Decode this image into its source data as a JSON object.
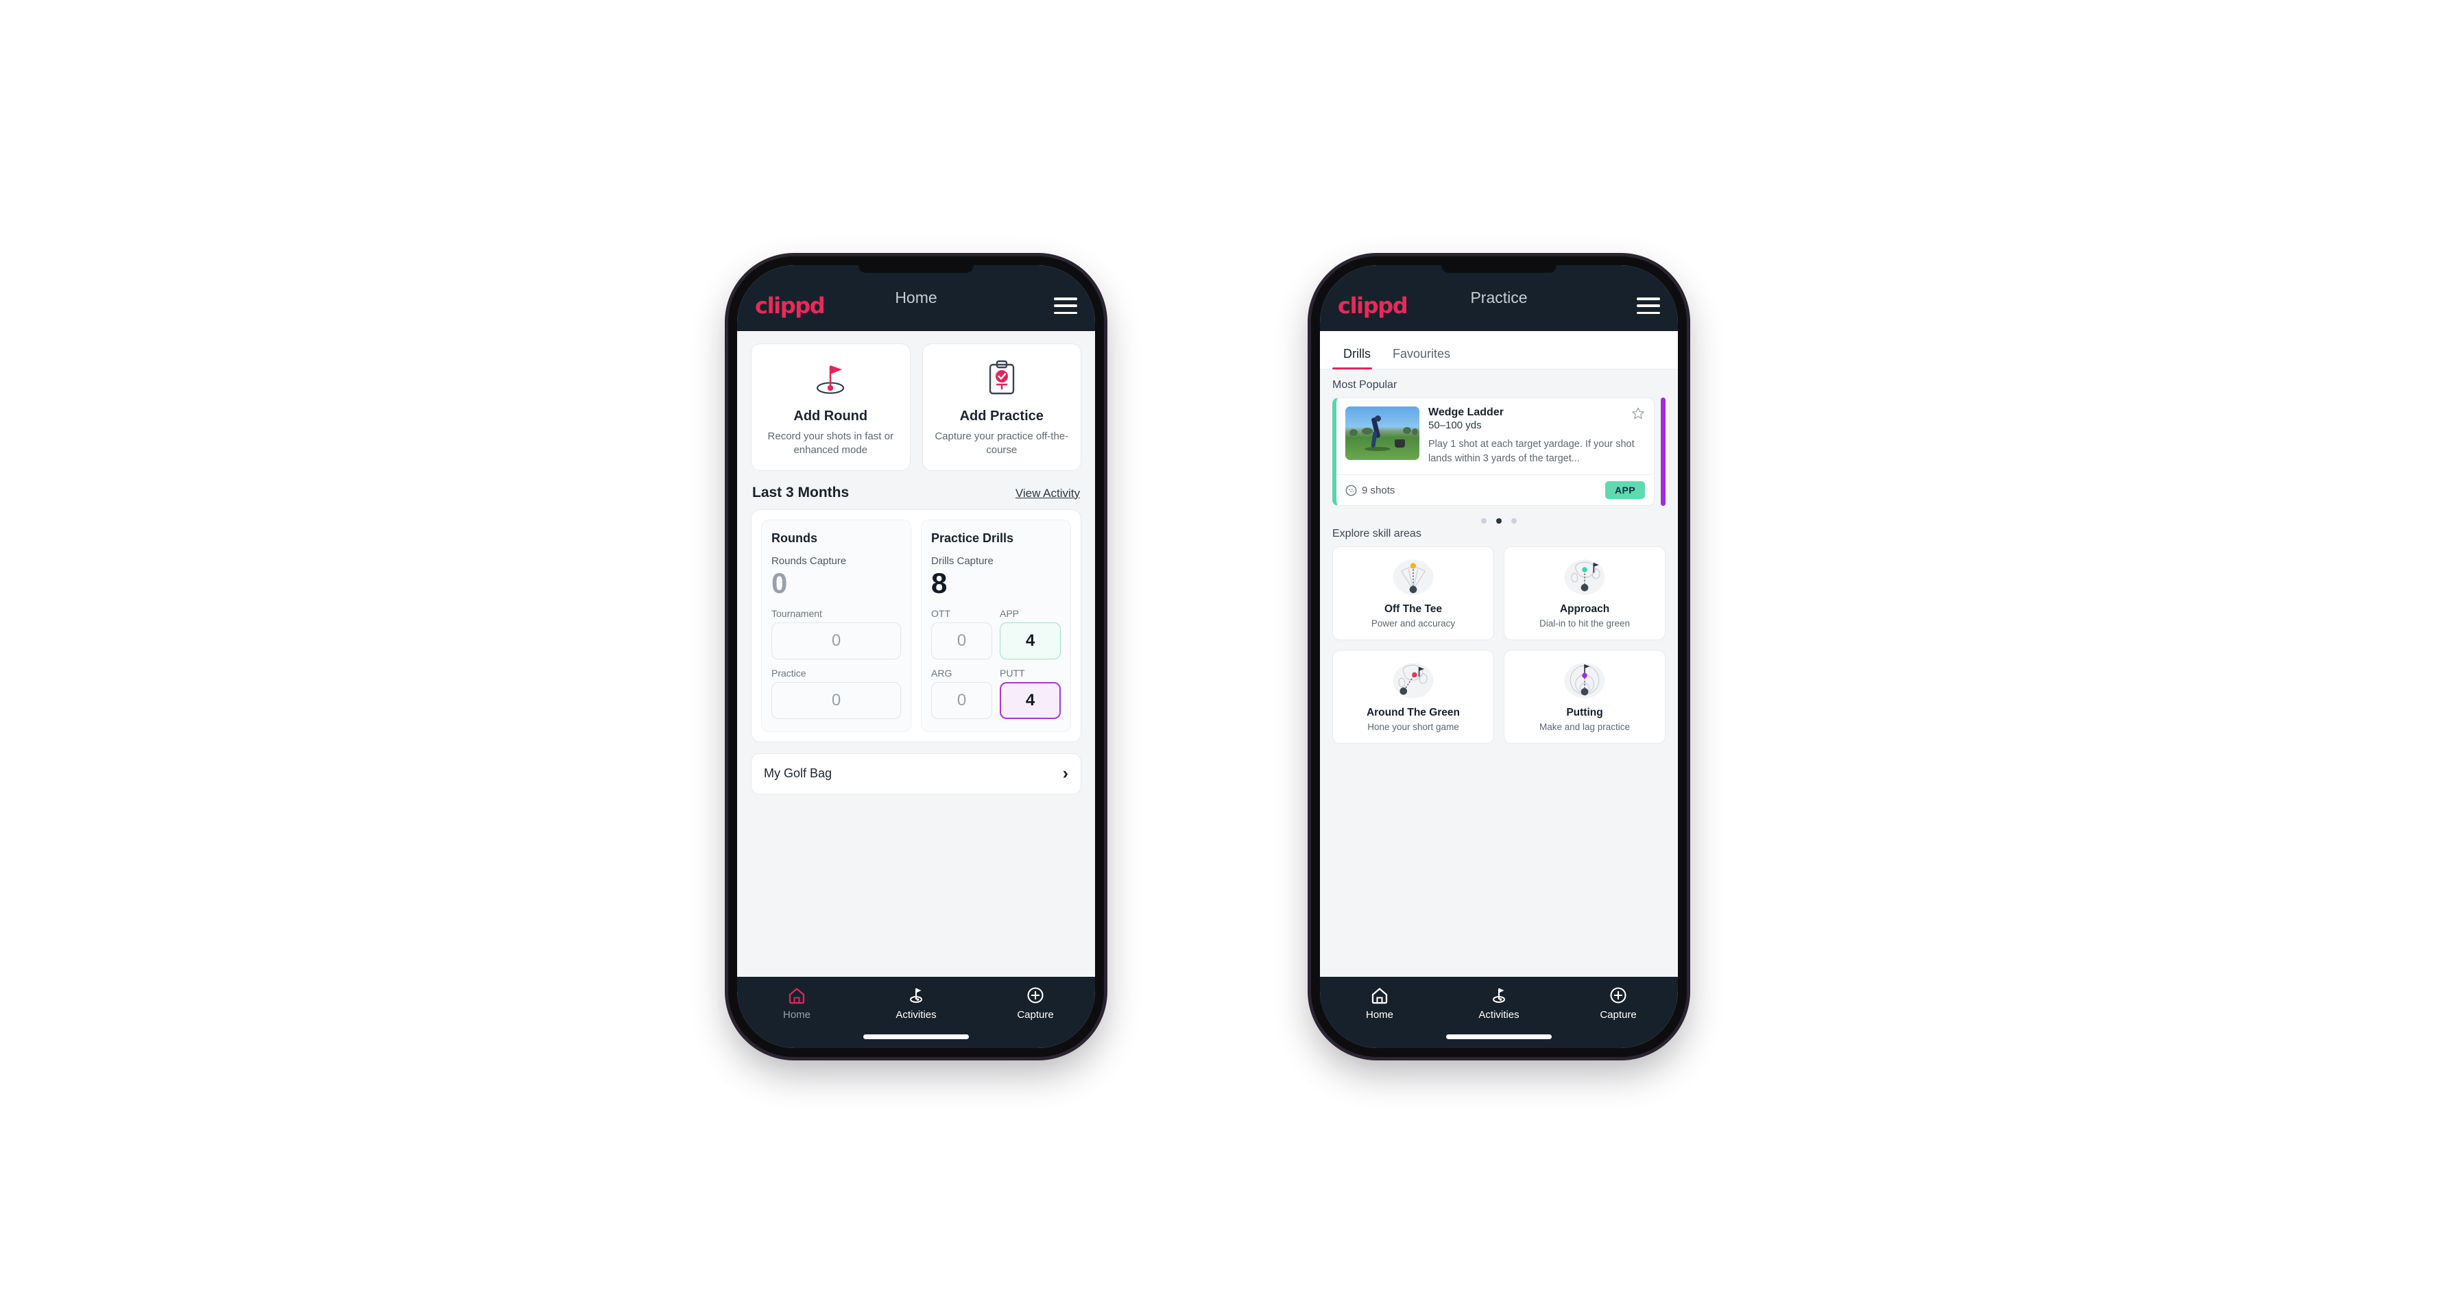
{
  "brand": {
    "name": "clippd",
    "accent": "#ea2a5a",
    "dark": "#17212b"
  },
  "phone_home": {
    "appbar": {
      "logo": "clippd",
      "title": "Home",
      "menu_icon": "hamburger-icon"
    },
    "quick_actions": [
      {
        "icon": "golf-flag-icon",
        "title": "Add Round",
        "subtitle": "Record your shots in fast or enhanced mode"
      },
      {
        "icon": "clipboard-check-icon",
        "title": "Add Practice",
        "subtitle": "Capture your practice off-the-course"
      }
    ],
    "section": {
      "title": "Last 3 Months",
      "link": "View Activity"
    },
    "rounds_panel": {
      "heading": "Rounds",
      "capture_label": "Rounds Capture",
      "capture_value": "0",
      "fields": [
        {
          "label": "Tournament",
          "value": "0",
          "state": "normal"
        },
        {
          "label": "Practice",
          "value": "0",
          "state": "normal"
        }
      ]
    },
    "drills_panel": {
      "heading": "Practice Drills",
      "capture_label": "Drills Capture",
      "capture_value": "8",
      "fields": [
        {
          "label": "OTT",
          "value": "0",
          "state": "normal"
        },
        {
          "label": "APP",
          "value": "4",
          "state": "green"
        },
        {
          "label": "ARG",
          "value": "0",
          "state": "normal"
        },
        {
          "label": "PUTT",
          "value": "4",
          "state": "purple"
        }
      ]
    },
    "golf_bag": {
      "label": "My Golf Bag",
      "chevron": "chevron-right-icon"
    },
    "bottom_nav": [
      {
        "icon": "home-icon",
        "label": "Home",
        "active": true
      },
      {
        "icon": "golf-flag-icon",
        "label": "Activities",
        "active": false
      },
      {
        "icon": "plus-circle-icon",
        "label": "Capture",
        "active": false
      }
    ]
  },
  "phone_practice": {
    "appbar": {
      "logo": "clippd",
      "title": "Practice",
      "menu_icon": "hamburger-icon"
    },
    "tabs": [
      {
        "label": "Drills",
        "active": true
      },
      {
        "label": "Favourites",
        "active": false
      }
    ],
    "most_popular_heading": "Most Popular",
    "featured_drill": {
      "title": "Wedge Ladder",
      "yardage": "50–100 yds",
      "description": "Play 1 shot at each target yardage. If your shot lands within 3 yards of the target...",
      "shots": "9 shots",
      "shots_icon": "golf-ball-icon",
      "badge": "APP",
      "badge_color": "#5fd9b0",
      "accent_color": "#57d6ac",
      "favourite_icon": "star-outline-icon",
      "next_accent_color": "#9b2fe0"
    },
    "carousel_dots": {
      "count": 3,
      "active_index": 1
    },
    "explore_heading": "Explore skill areas",
    "skill_areas": [
      {
        "icon": "tee-shot-icon",
        "name": "Off The Tee",
        "subtitle": "Power and accuracy",
        "dot_color": "#f5b327"
      },
      {
        "icon": "approach-green-icon",
        "name": "Approach",
        "subtitle": "Dial-in to hit the green",
        "dot_color": "#42d4a8"
      },
      {
        "icon": "chip-green-icon",
        "name": "Around The Green",
        "subtitle": "Hone your short game",
        "dot_color": "#e8355f"
      },
      {
        "icon": "putting-rings-icon",
        "name": "Putting",
        "subtitle": "Make and lag practice",
        "dot_color": "#9b2fe0"
      }
    ],
    "bottom_nav": [
      {
        "icon": "home-icon",
        "label": "Home",
        "active": false
      },
      {
        "icon": "golf-flag-icon",
        "label": "Activities",
        "active": false
      },
      {
        "icon": "plus-circle-icon",
        "label": "Capture",
        "active": false
      }
    ]
  }
}
